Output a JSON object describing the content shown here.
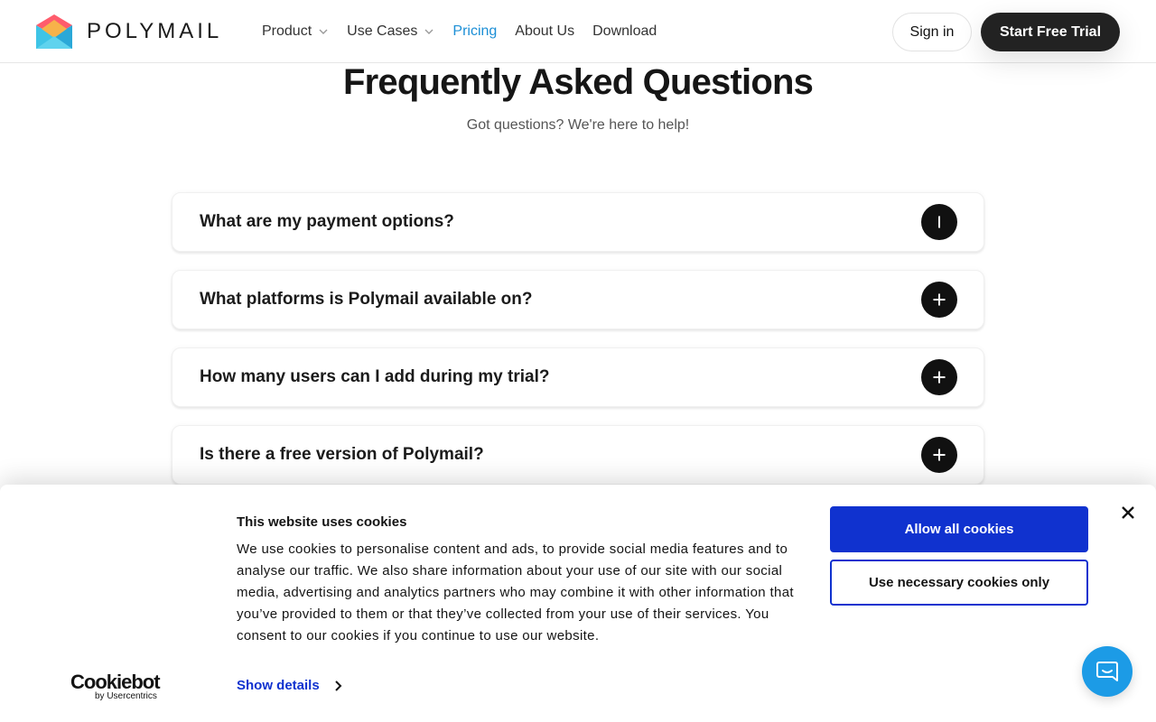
{
  "header": {
    "brand": "POLYMAIL",
    "nav": [
      {
        "label": "Product",
        "has_dropdown": true
      },
      {
        "label": "Use Cases",
        "has_dropdown": true
      },
      {
        "label": "Pricing",
        "active": true
      },
      {
        "label": "About Us"
      },
      {
        "label": "Download"
      }
    ],
    "signin_label": "Sign in",
    "trial_label": "Start Free Trial"
  },
  "faq": {
    "title": "Frequently Asked Questions",
    "subtitle": "Got questions? We're here to help!",
    "items": [
      {
        "question": "What are my payment options?",
        "icon": "minus-icon",
        "expanded": true
      },
      {
        "question": "What platforms is Polymail available on?",
        "icon": "plus-icon",
        "expanded": false
      },
      {
        "question": "How many users can I add during my trial?",
        "icon": "plus-icon",
        "expanded": false
      },
      {
        "question": "Is there a free version of Polymail?",
        "icon": "plus-icon",
        "expanded": false
      }
    ]
  },
  "cookie_banner": {
    "title": "This website uses cookies",
    "text": "We use cookies to personalise content and ads, to provide social media features and to analyse our traffic. We also share information about your use of our site with our social media, advertising and analytics partners who may combine it with other information that you’ve provided to them or that they’ve collected from your use of their services. You consent to our cookies if you continue to use our website.",
    "show_details": "Show details",
    "allow_all": "Allow all cookies",
    "necessary_only": "Use necessary cookies only",
    "logo_name": "Cookiebot",
    "logo_by": "by Usercentrics"
  },
  "colors": {
    "accent": "#1c8fd6",
    "cookie_blue": "#1032cf",
    "dark_button": "#222222",
    "chat_blue": "#1c9be6"
  }
}
